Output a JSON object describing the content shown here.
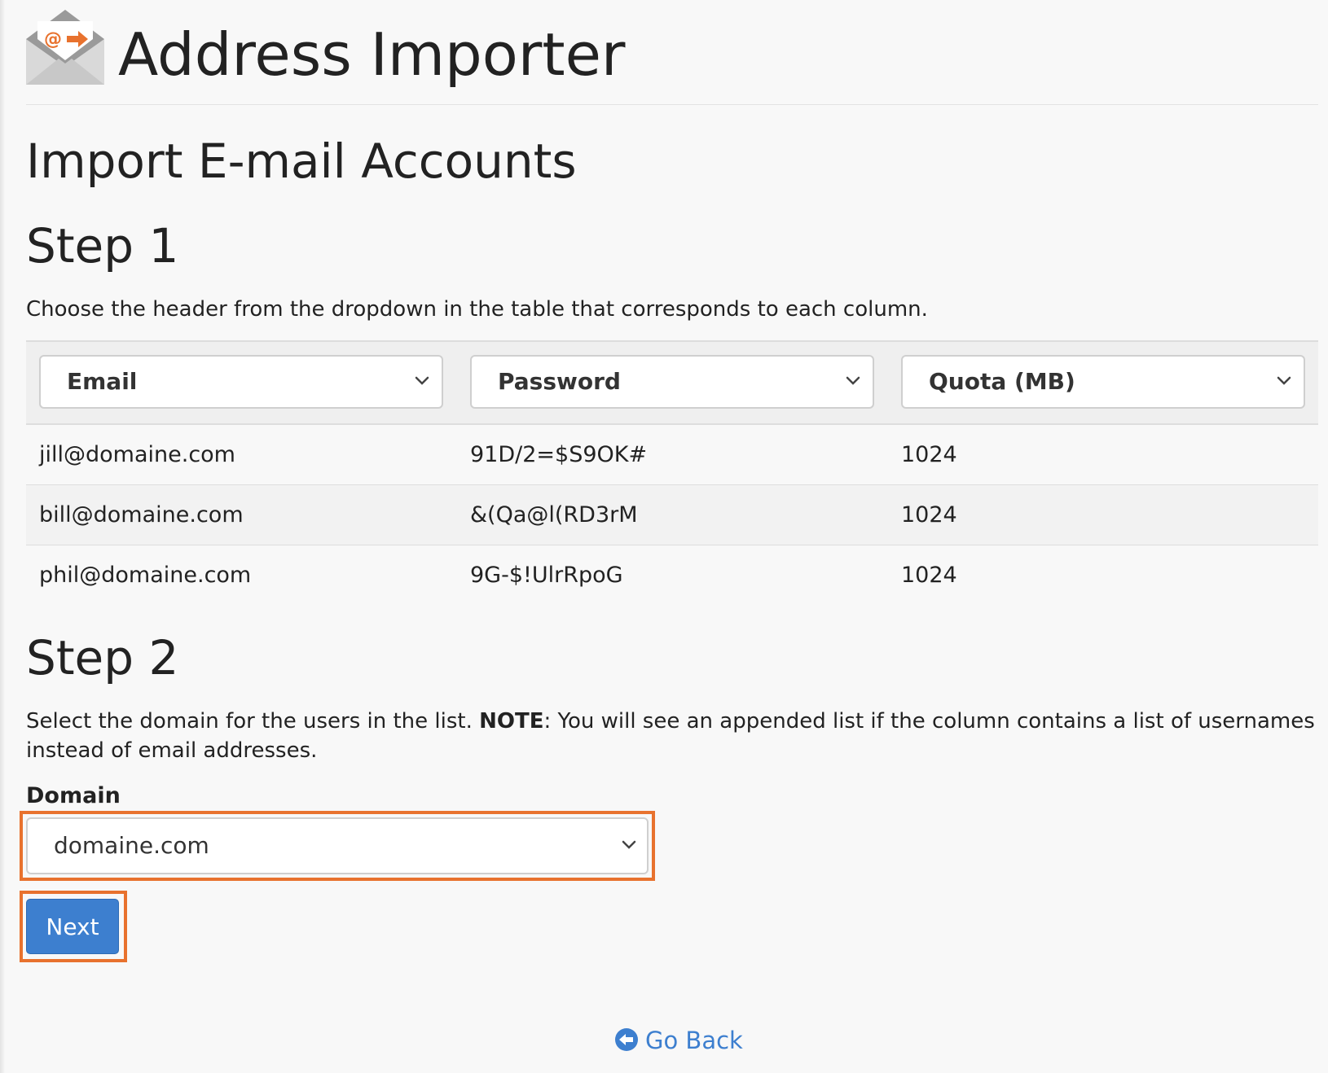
{
  "app": {
    "title": "Address Importer"
  },
  "page": {
    "title": "Import E-mail Accounts"
  },
  "step1": {
    "heading": "Step 1",
    "instruction": "Choose the header from the dropdown in the table that corresponds to each column.",
    "column_selects": [
      {
        "selected": "Email"
      },
      {
        "selected": "Password"
      },
      {
        "selected": "Quota (MB)"
      }
    ],
    "rows": [
      {
        "email": "jill@domaine.com",
        "password": "91D/2=$S9OK#",
        "quota": "1024"
      },
      {
        "email": "bill@domaine.com",
        "password": "&(Qa@l(RD3rM",
        "quota": "1024"
      },
      {
        "email": "phil@domaine.com",
        "password": "9G-$!UlrRpoG",
        "quota": "1024"
      }
    ]
  },
  "step2": {
    "heading": "Step 2",
    "instruction_before": "Select the domain for the users in the list. ",
    "note_label": "NOTE",
    "instruction_after": ": You will see an appended list if the column contains a list of usernames instead of email addresses.",
    "domain_label": "Domain",
    "domain_selected": "domaine.com",
    "next_label": "Next"
  },
  "footer": {
    "go_back_label": "Go Back"
  },
  "colors": {
    "accent_orange": "#e8722e",
    "primary_blue": "#3d7fcf",
    "background": "#f8f8f8"
  },
  "icons": {
    "app_icon": "envelope-at-arrow-icon",
    "select_chevron": "chevron-down-icon",
    "go_back": "circle-arrow-left-icon"
  }
}
